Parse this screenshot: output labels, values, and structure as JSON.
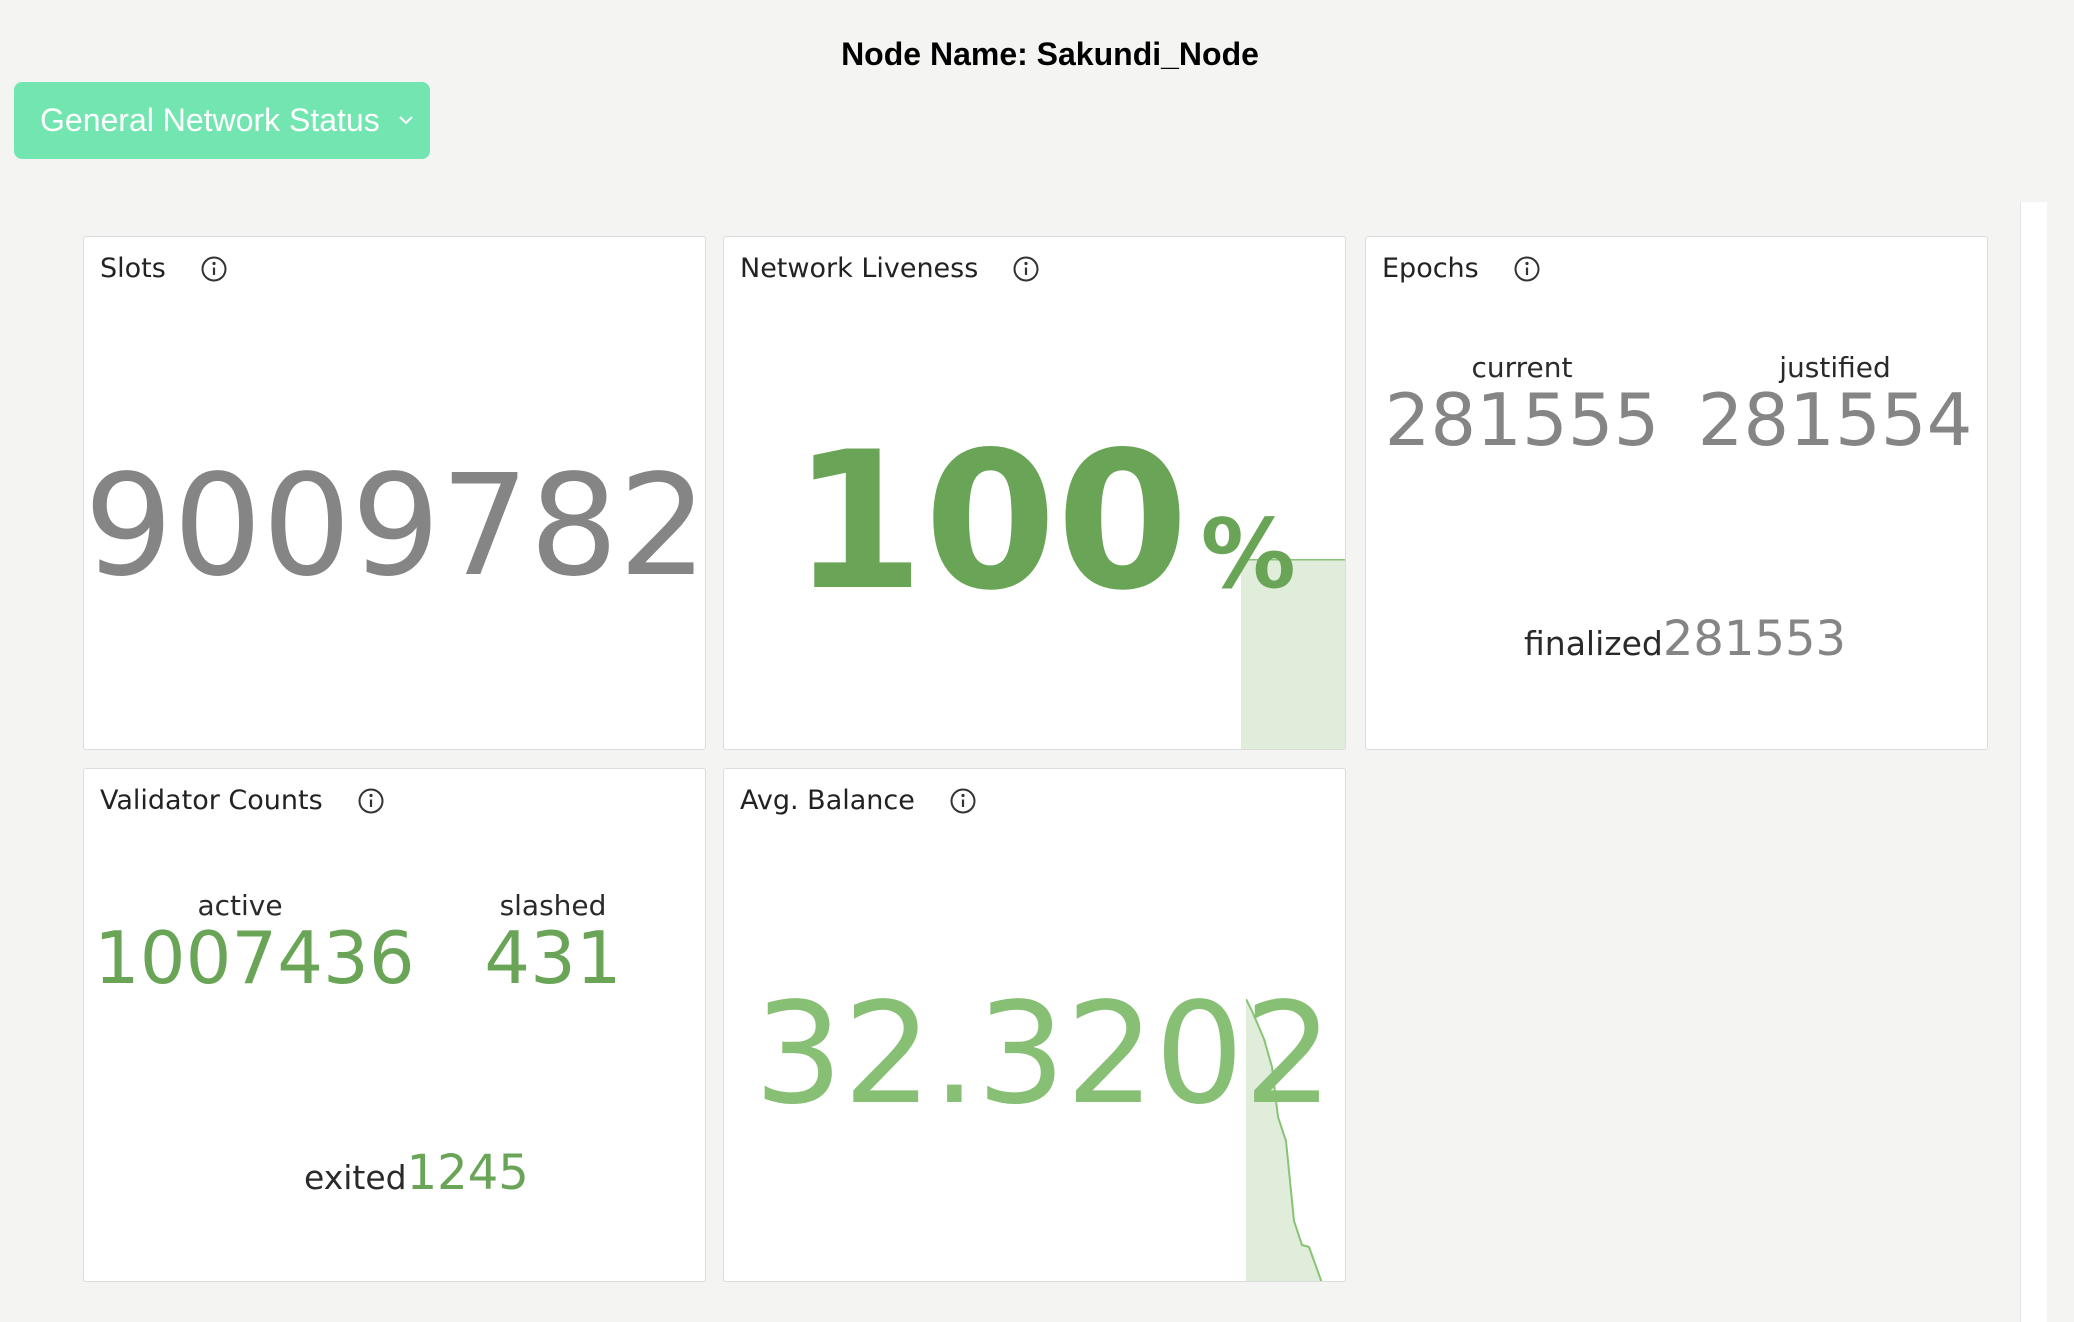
{
  "header": {
    "node_title": "Node Name: Sakundi_Node",
    "dashboard_select": "General Network Status"
  },
  "panels": {
    "slots": {
      "title": "Slots",
      "value": "9009782"
    },
    "liveness": {
      "title": "Network Liveness",
      "value": "100",
      "unit": "%",
      "sparkline_level": 1.0
    },
    "epochs": {
      "title": "Epochs",
      "current_label": "current",
      "current_value": "281555",
      "justified_label": "justified",
      "justified_value": "281554",
      "finalized_label": "finalized",
      "finalized_value": "281553"
    },
    "validators": {
      "title": "Validator Counts",
      "active_label": "active",
      "active_value": "1007436",
      "slashed_label": "slashed",
      "slashed_value": "431",
      "exited_label": "exited",
      "exited_value": "1245"
    },
    "balance": {
      "title": "Avg. Balance",
      "value": "32.3202"
    }
  },
  "colors": {
    "accent": "#73e5b1",
    "grey_value": "#858585",
    "green_value": "#6aa557",
    "light_green_value": "#87bf74",
    "sparkline_fill": "#e1eddb",
    "sparkline_line": "#88c476"
  },
  "icons": {
    "info": "info-circle-icon",
    "dropdown": "chevron-down-icon"
  }
}
